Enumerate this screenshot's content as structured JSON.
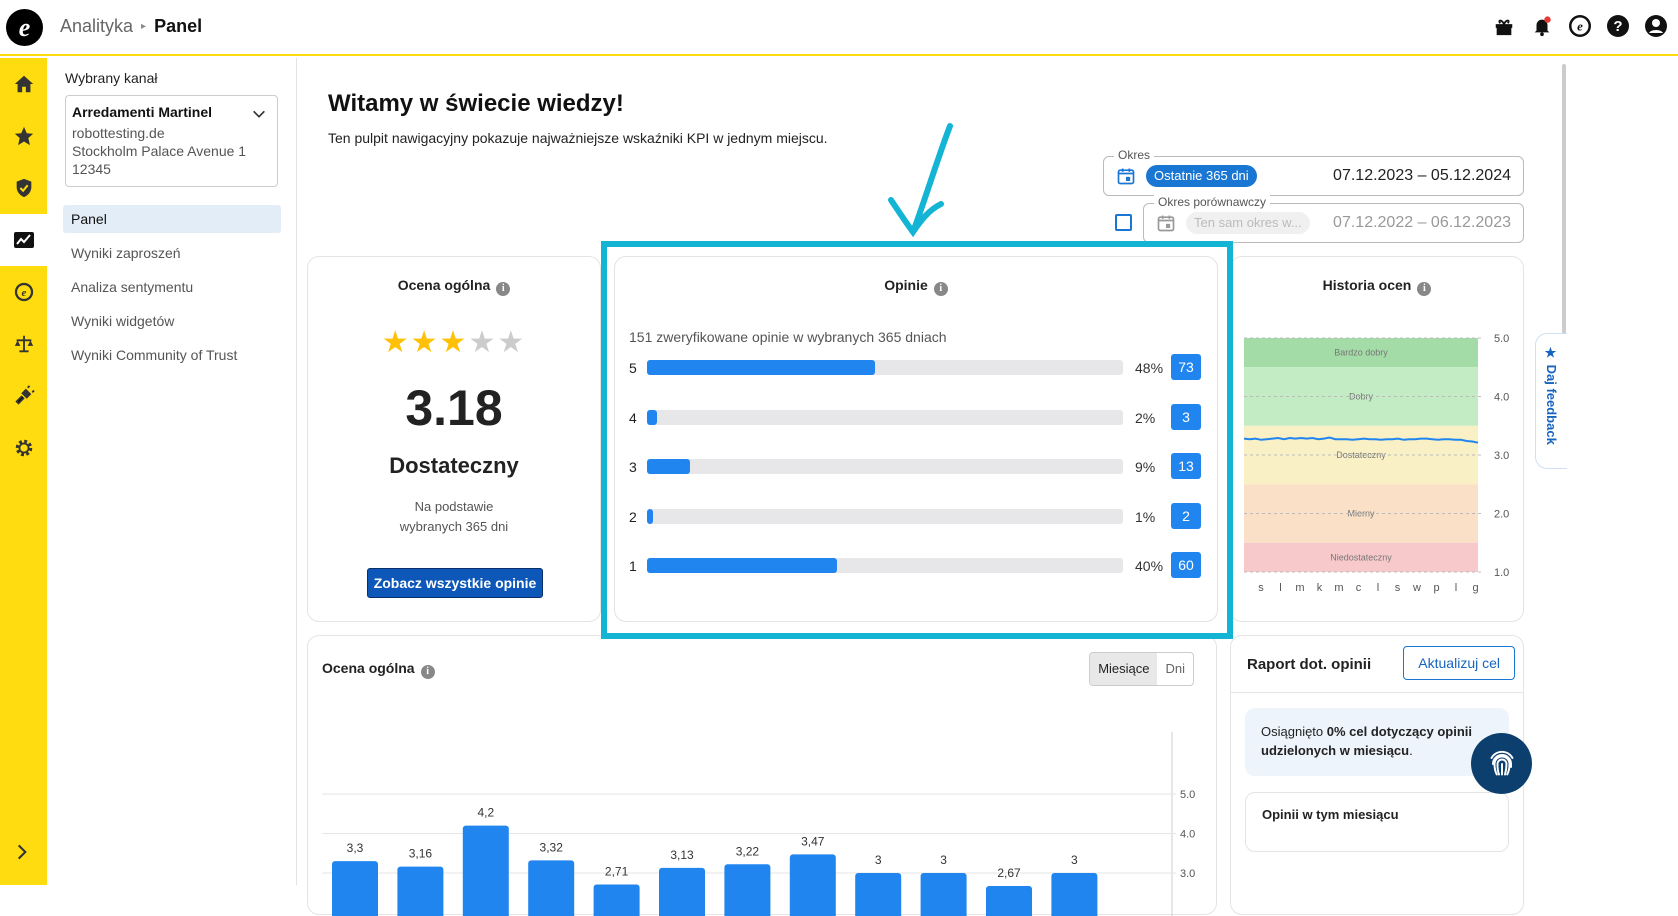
{
  "header": {
    "section": "Analityka",
    "page": "Panel"
  },
  "channel": {
    "label": "Wybrany kanał",
    "name": "Arredamenti Martinel",
    "domain": "robottesting.de",
    "address": "Stockholm Palace Avenue 1",
    "zip": "12345"
  },
  "menu": [
    {
      "label": "Panel",
      "active": true
    },
    {
      "label": "Wyniki zaproszeń"
    },
    {
      "label": "Analiza sentymentu"
    },
    {
      "label": "Wyniki widgetów"
    },
    {
      "label": "Wyniki Community of Trust"
    }
  ],
  "welcome": {
    "title": "Witamy w świecie wiedzy!",
    "subtitle": "Ten pulpit nawigacyjny pokazuje najważniejsze wskaźniki KPI w jednym miejscu."
  },
  "period": {
    "legend": "Okres",
    "chip": "Ostatnie 365 dni",
    "dates": "07.12.2023 – 05.12.2024"
  },
  "compare": {
    "legend": "Okres porównawczy",
    "chip": "Ten sam okres w...",
    "dates": "07.12.2022 – 06.12.2023",
    "checked": false
  },
  "overall": {
    "title": "Ocena ogólna",
    "stars": 3,
    "score": "3.18",
    "label": "Dostateczny",
    "basis_1": "Na podstawie",
    "basis_2": "wybranych 365 dni",
    "button": "Zobacz wszystkie opinie"
  },
  "reviews": {
    "title": "Opinie",
    "summary": "151 zweryfikowane opinie w wybranych 365 dniach",
    "rows": [
      {
        "stars": "5",
        "pct": 48,
        "pct_label": "48%",
        "count": "73"
      },
      {
        "stars": "4",
        "pct": 2,
        "pct_label": "2%",
        "count": "3"
      },
      {
        "stars": "3",
        "pct": 9,
        "pct_label": "9%",
        "count": "13"
      },
      {
        "stars": "2",
        "pct": 1,
        "pct_label": "1%",
        "count": "2"
      },
      {
        "stars": "1",
        "pct": 40,
        "pct_label": "40%",
        "count": "60"
      }
    ]
  },
  "history": {
    "title": "Historia ocen",
    "bands": [
      "Bardzo dobry",
      "Dobry",
      "Dostateczny",
      "Mierny",
      "Niedostateczny"
    ],
    "band_colors": [
      "#a3dca6",
      "#c3ebc4",
      "#f9f0c5",
      "#fbe0c8",
      "#f7c9cb"
    ],
    "y_ticks": [
      "5.0",
      "4.0",
      "3.0",
      "2.0",
      "1.0"
    ],
    "months": [
      "s",
      "l",
      "m",
      "k",
      "m",
      "c",
      "l",
      "s",
      "w",
      "p",
      "l",
      "g"
    ]
  },
  "chart_data": [
    {
      "type": "line",
      "title": "Historia ocen",
      "ylim": [
        1,
        5
      ],
      "y": [
        3.28,
        3.27,
        3.28,
        3.26,
        3.27,
        3.28,
        3.29,
        3.27,
        3.29,
        3.28,
        3.29,
        3.28,
        3.29,
        3.27,
        3.28,
        3.3,
        3.27,
        3.27,
        3.27,
        3.26,
        3.27,
        3.28,
        3.27,
        3.27,
        3.26,
        3.27,
        3.27,
        3.28,
        3.26,
        3.27,
        3.27,
        3.28,
        3.28,
        3.27,
        3.26,
        3.27,
        3.27,
        3.26,
        3.26,
        3.24,
        3.23,
        3.21
      ]
    },
    {
      "type": "bar",
      "title": "Ocena ogólna",
      "values": [
        3.3,
        3.16,
        4.2,
        3.32,
        2.71,
        3.13,
        3.22,
        3.47,
        3.0,
        3.0,
        2.67,
        3.0
      ],
      "labels": [
        "3,3",
        "3,16",
        "4,2",
        "3,32",
        "2,71",
        "3,13",
        "3,22",
        "3,47",
        "3",
        "3",
        "2,67",
        "3"
      ],
      "y_ticks": [
        "5.0",
        "4.0",
        "3.0"
      ]
    }
  ],
  "monthly": {
    "title": "Ocena ogólna",
    "seg_month": "Miesiące",
    "seg_day": "Dni"
  },
  "report": {
    "title": "Raport dot. opinii",
    "button": "Aktualizuj cel",
    "goal_pre": "Osiągnięto ",
    "goal_bold": "0% cel dotyczący opinii udzielonych w miesiącu",
    "goal_post": ".",
    "sub": "Opinii w tym miesiącu"
  },
  "feedback": "★ Daj feedback",
  "colors": {
    "brand_yellow": "#ffdc0f",
    "accent_blue": "#2185f0",
    "highlight": "#14b4d4"
  }
}
